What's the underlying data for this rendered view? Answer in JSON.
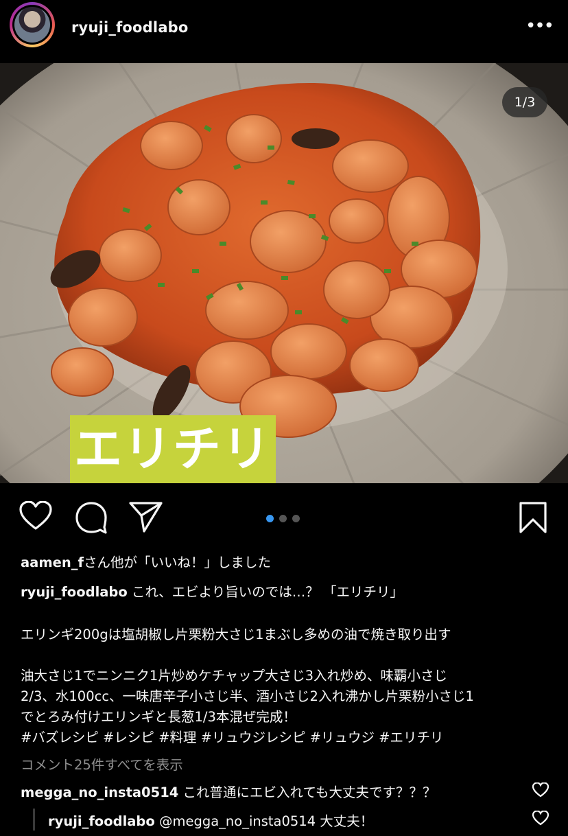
{
  "header": {
    "username": "ryuji_foodlabo",
    "more_glyph": "•••"
  },
  "post": {
    "counter": "1/3",
    "image_title": "エリチリ",
    "carousel_dots": 3,
    "active_dot": 0
  },
  "likes": {
    "user": "aamen_f",
    "text": "さん他が「いいね！」しました"
  },
  "caption": {
    "user": "ryuji_foodlabo",
    "line1": "これ、エビより旨いのでは…？ 「エリチリ」",
    "line2": "エリンギ200gは塩胡椒し片栗粉大さじ1まぶし多めの油で焼き取り出す",
    "line3": "油大さじ1でニンニク1片炒めケチャップ大さじ3入れ炒め、味覇小さじ",
    "line4": "2/3、水100cc、一味唐辛子小さじ半、酒小さじ2入れ沸かし片栗粉小さじ1",
    "line5": "でとろみ付けエリンギと長葱1/3本混ぜ完成！",
    "hashtags": "#バズレシピ #レシピ #料理 #リュウジレシピ #リュウジ #エリチリ"
  },
  "comments_link": "コメント25件すべてを表示",
  "comments": [
    {
      "user": "megga_no_insta0514",
      "text": "これ普通にエビ入れても大丈夫です？？？"
    },
    {
      "user": "ryuji_foodlabo",
      "text": "@megga_no_insta0514 大丈夫！"
    }
  ],
  "icons": [
    "heart-icon",
    "comment-icon",
    "share-icon",
    "bookmark-icon",
    "more-icon"
  ],
  "colors": {
    "background": "#000000",
    "accent": "#3897f0",
    "label_bg": "#c6d33c"
  }
}
